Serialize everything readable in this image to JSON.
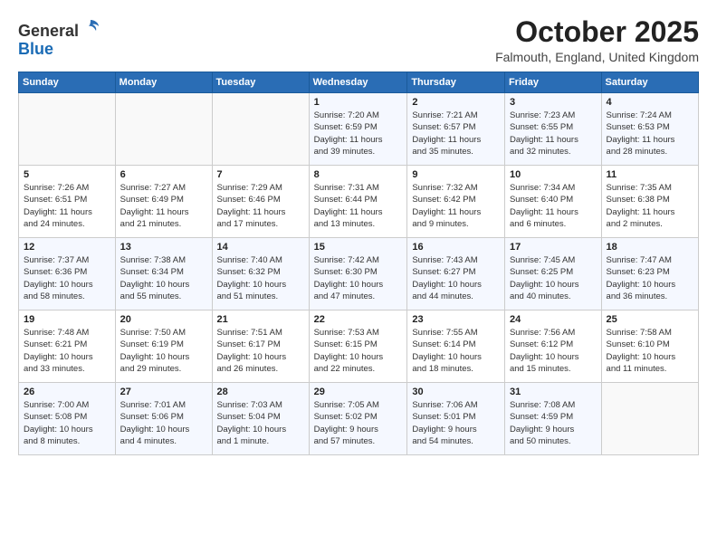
{
  "header": {
    "logo_line1": "General",
    "logo_line2": "Blue",
    "month_title": "October 2025",
    "location": "Falmouth, England, United Kingdom"
  },
  "weekdays": [
    "Sunday",
    "Monday",
    "Tuesday",
    "Wednesday",
    "Thursday",
    "Friday",
    "Saturday"
  ],
  "weeks": [
    [
      {
        "day": "",
        "info": ""
      },
      {
        "day": "",
        "info": ""
      },
      {
        "day": "",
        "info": ""
      },
      {
        "day": "1",
        "info": "Sunrise: 7:20 AM\nSunset: 6:59 PM\nDaylight: 11 hours\nand 39 minutes."
      },
      {
        "day": "2",
        "info": "Sunrise: 7:21 AM\nSunset: 6:57 PM\nDaylight: 11 hours\nand 35 minutes."
      },
      {
        "day": "3",
        "info": "Sunrise: 7:23 AM\nSunset: 6:55 PM\nDaylight: 11 hours\nand 32 minutes."
      },
      {
        "day": "4",
        "info": "Sunrise: 7:24 AM\nSunset: 6:53 PM\nDaylight: 11 hours\nand 28 minutes."
      }
    ],
    [
      {
        "day": "5",
        "info": "Sunrise: 7:26 AM\nSunset: 6:51 PM\nDaylight: 11 hours\nand 24 minutes."
      },
      {
        "day": "6",
        "info": "Sunrise: 7:27 AM\nSunset: 6:49 PM\nDaylight: 11 hours\nand 21 minutes."
      },
      {
        "day": "7",
        "info": "Sunrise: 7:29 AM\nSunset: 6:46 PM\nDaylight: 11 hours\nand 17 minutes."
      },
      {
        "day": "8",
        "info": "Sunrise: 7:31 AM\nSunset: 6:44 PM\nDaylight: 11 hours\nand 13 minutes."
      },
      {
        "day": "9",
        "info": "Sunrise: 7:32 AM\nSunset: 6:42 PM\nDaylight: 11 hours\nand 9 minutes."
      },
      {
        "day": "10",
        "info": "Sunrise: 7:34 AM\nSunset: 6:40 PM\nDaylight: 11 hours\nand 6 minutes."
      },
      {
        "day": "11",
        "info": "Sunrise: 7:35 AM\nSunset: 6:38 PM\nDaylight: 11 hours\nand 2 minutes."
      }
    ],
    [
      {
        "day": "12",
        "info": "Sunrise: 7:37 AM\nSunset: 6:36 PM\nDaylight: 10 hours\nand 58 minutes."
      },
      {
        "day": "13",
        "info": "Sunrise: 7:38 AM\nSunset: 6:34 PM\nDaylight: 10 hours\nand 55 minutes."
      },
      {
        "day": "14",
        "info": "Sunrise: 7:40 AM\nSunset: 6:32 PM\nDaylight: 10 hours\nand 51 minutes."
      },
      {
        "day": "15",
        "info": "Sunrise: 7:42 AM\nSunset: 6:30 PM\nDaylight: 10 hours\nand 47 minutes."
      },
      {
        "day": "16",
        "info": "Sunrise: 7:43 AM\nSunset: 6:27 PM\nDaylight: 10 hours\nand 44 minutes."
      },
      {
        "day": "17",
        "info": "Sunrise: 7:45 AM\nSunset: 6:25 PM\nDaylight: 10 hours\nand 40 minutes."
      },
      {
        "day": "18",
        "info": "Sunrise: 7:47 AM\nSunset: 6:23 PM\nDaylight: 10 hours\nand 36 minutes."
      }
    ],
    [
      {
        "day": "19",
        "info": "Sunrise: 7:48 AM\nSunset: 6:21 PM\nDaylight: 10 hours\nand 33 minutes."
      },
      {
        "day": "20",
        "info": "Sunrise: 7:50 AM\nSunset: 6:19 PM\nDaylight: 10 hours\nand 29 minutes."
      },
      {
        "day": "21",
        "info": "Sunrise: 7:51 AM\nSunset: 6:17 PM\nDaylight: 10 hours\nand 26 minutes."
      },
      {
        "day": "22",
        "info": "Sunrise: 7:53 AM\nSunset: 6:15 PM\nDaylight: 10 hours\nand 22 minutes."
      },
      {
        "day": "23",
        "info": "Sunrise: 7:55 AM\nSunset: 6:14 PM\nDaylight: 10 hours\nand 18 minutes."
      },
      {
        "day": "24",
        "info": "Sunrise: 7:56 AM\nSunset: 6:12 PM\nDaylight: 10 hours\nand 15 minutes."
      },
      {
        "day": "25",
        "info": "Sunrise: 7:58 AM\nSunset: 6:10 PM\nDaylight: 10 hours\nand 11 minutes."
      }
    ],
    [
      {
        "day": "26",
        "info": "Sunrise: 7:00 AM\nSunset: 5:08 PM\nDaylight: 10 hours\nand 8 minutes."
      },
      {
        "day": "27",
        "info": "Sunrise: 7:01 AM\nSunset: 5:06 PM\nDaylight: 10 hours\nand 4 minutes."
      },
      {
        "day": "28",
        "info": "Sunrise: 7:03 AM\nSunset: 5:04 PM\nDaylight: 10 hours\nand 1 minute."
      },
      {
        "day": "29",
        "info": "Sunrise: 7:05 AM\nSunset: 5:02 PM\nDaylight: 9 hours\nand 57 minutes."
      },
      {
        "day": "30",
        "info": "Sunrise: 7:06 AM\nSunset: 5:01 PM\nDaylight: 9 hours\nand 54 minutes."
      },
      {
        "day": "31",
        "info": "Sunrise: 7:08 AM\nSunset: 4:59 PM\nDaylight: 9 hours\nand 50 minutes."
      },
      {
        "day": "",
        "info": ""
      }
    ]
  ]
}
